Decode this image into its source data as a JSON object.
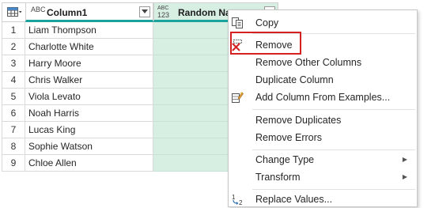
{
  "grid": {
    "columns": [
      {
        "type_badge": "ABC",
        "title": "Column1"
      },
      {
        "type_badge_top": "ABC",
        "type_badge_bottom": "123",
        "title": "Random Names"
      }
    ],
    "rows": [
      {
        "index": "1",
        "name": "Liam Thompson"
      },
      {
        "index": "2",
        "name": "Charlotte White"
      },
      {
        "index": "3",
        "name": "Harry Moore"
      },
      {
        "index": "4",
        "name": "Chris Walker"
      },
      {
        "index": "5",
        "name": "Viola Levato"
      },
      {
        "index": "6",
        "name": "Noah Harris"
      },
      {
        "index": "7",
        "name": "Lucas King"
      },
      {
        "index": "8",
        "name": "Sophie Watson"
      },
      {
        "index": "9",
        "name": "Chloe Allen"
      }
    ]
  },
  "menu": {
    "copy": "Copy",
    "remove": "Remove",
    "remove_other_columns": "Remove Other Columns",
    "duplicate_column": "Duplicate Column",
    "add_column_from_examples": "Add Column From Examples...",
    "remove_duplicates": "Remove Duplicates",
    "remove_errors": "Remove Errors",
    "change_type": "Change Type",
    "transform": "Transform",
    "replace_values": "Replace Values..."
  },
  "colors": {
    "selected_column": "#d7eee2",
    "header_accent": "#1aa39b",
    "highlight": "#d42020"
  },
  "icons": {
    "table": "table-icon",
    "copy": "copy-icon",
    "remove": "remove-icon",
    "add_column": "add-column-icon",
    "replace": "replace-values-icon"
  }
}
